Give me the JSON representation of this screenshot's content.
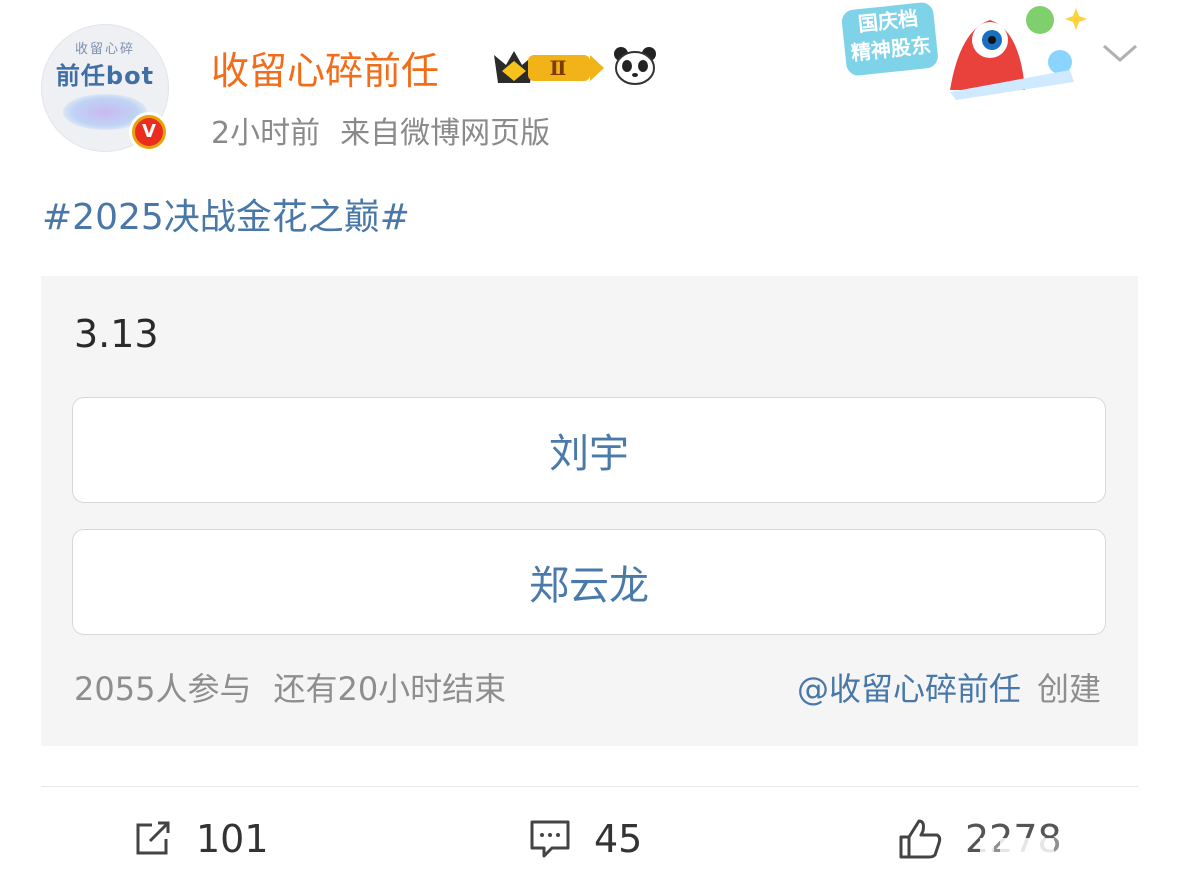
{
  "user": {
    "name": "收留心碎前任",
    "avatar_text_small": "收留心碎",
    "avatar_text_big": "前任bot",
    "verified_mark": "V",
    "level_badge": "Ⅱ",
    "time": "2小时前",
    "source": "来自微博网页版"
  },
  "promo": {
    "line1": "国庆档",
    "line2": "精神股东"
  },
  "post": {
    "hashtag": "#2025决战金花之巅#"
  },
  "poll": {
    "title": "3.13",
    "options": [
      {
        "label": "刘宇"
      },
      {
        "label": "郑云龙"
      }
    ],
    "participants": "2055人参与",
    "remaining": "还有20小时结束",
    "creator_mention": "@收留心碎前任",
    "creator_suffix": "创建"
  },
  "actions": {
    "share_count": "101",
    "comment_count": "45",
    "like_count": "2278"
  },
  "colors": {
    "username": "#f26d1a",
    "link": "#4978a8",
    "option_text": "#4a7aaa",
    "poll_bg": "#f5f5f5"
  }
}
